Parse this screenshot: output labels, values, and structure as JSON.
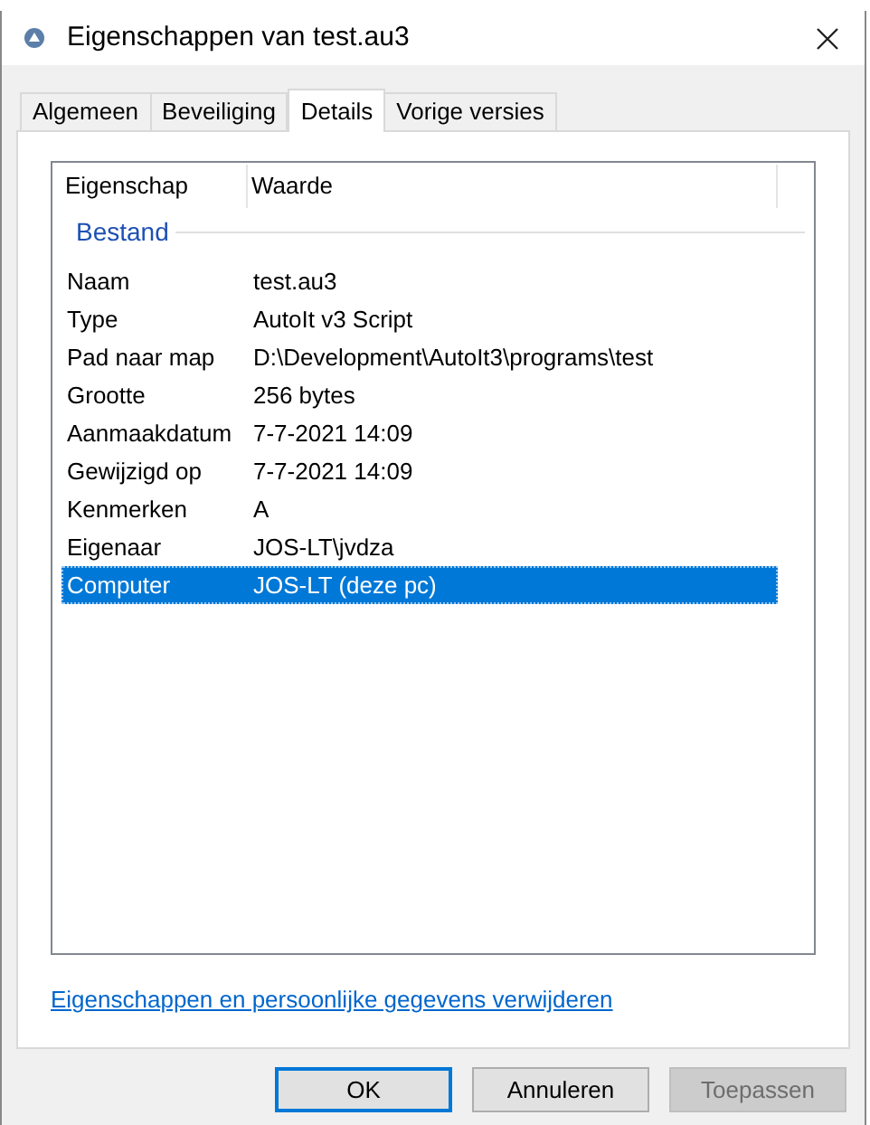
{
  "window": {
    "title": "Eigenschappen van test.au3"
  },
  "tabs": [
    {
      "label": "Algemeen",
      "selected": false
    },
    {
      "label": "Beveiliging",
      "selected": false
    },
    {
      "label": "Details",
      "selected": true
    },
    {
      "label": "Vorige versies",
      "selected": false
    }
  ],
  "table": {
    "columns": [
      "Eigenschap",
      "Waarde"
    ],
    "group": "Bestand",
    "rows": [
      {
        "cells": [
          "Naam",
          "test.au3"
        ],
        "selected": false
      },
      {
        "cells": [
          "Type",
          "AutoIt v3 Script"
        ],
        "selected": false
      },
      {
        "cells": [
          "Pad naar map",
          "D:\\Development\\AutoIt3\\programs\\test"
        ],
        "selected": false
      },
      {
        "cells": [
          "Grootte",
          "256 bytes"
        ],
        "selected": false
      },
      {
        "cells": [
          "Aanmaakdatum",
          "7-7-2021 14:09"
        ],
        "selected": false
      },
      {
        "cells": [
          "Gewijzigd op",
          "7-7-2021 14:09"
        ],
        "selected": false
      },
      {
        "cells": [
          "Kenmerken",
          "A"
        ],
        "selected": false
      },
      {
        "cells": [
          "Eigenaar",
          "JOS-LT\\jvdza"
        ],
        "selected": false
      },
      {
        "cells": [
          "Computer",
          "JOS-LT (deze pc)"
        ],
        "selected": true
      }
    ]
  },
  "link": "Eigenschappen en persoonlijke gegevens verwijderen",
  "buttons": [
    {
      "label": "OK",
      "default": true,
      "disabled": false
    },
    {
      "label": "Annuleren",
      "default": false,
      "disabled": false
    },
    {
      "label": "Toepassen",
      "default": false,
      "disabled": true
    }
  ]
}
